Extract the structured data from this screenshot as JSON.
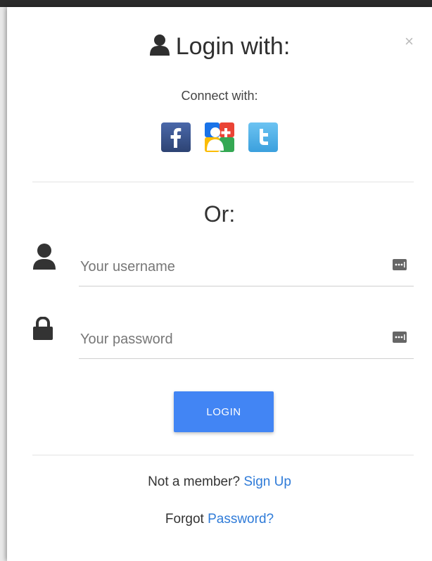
{
  "modal": {
    "title": "Login with:",
    "close_symbol": "×",
    "connect_label": "Connect with:",
    "socials": [
      {
        "name": "facebook",
        "glyph": "f",
        "color": "#3b5998"
      },
      {
        "name": "google",
        "glyph": "8",
        "color": "#ffffff"
      },
      {
        "name": "twitter",
        "glyph": "t",
        "color": "#55acee"
      }
    ],
    "or_label": "Or:"
  },
  "form": {
    "username_placeholder": "Your username",
    "username_value": "",
    "password_placeholder": "Your password",
    "password_value": "",
    "login_label": "LOGIN"
  },
  "footer": {
    "member_text": "Not a member?",
    "signup_link": "Sign Up",
    "forgot_text": "Forgot",
    "password_link": "Password?"
  },
  "colors": {
    "accent": "#4285f4",
    "link": "#2f7bd8"
  }
}
